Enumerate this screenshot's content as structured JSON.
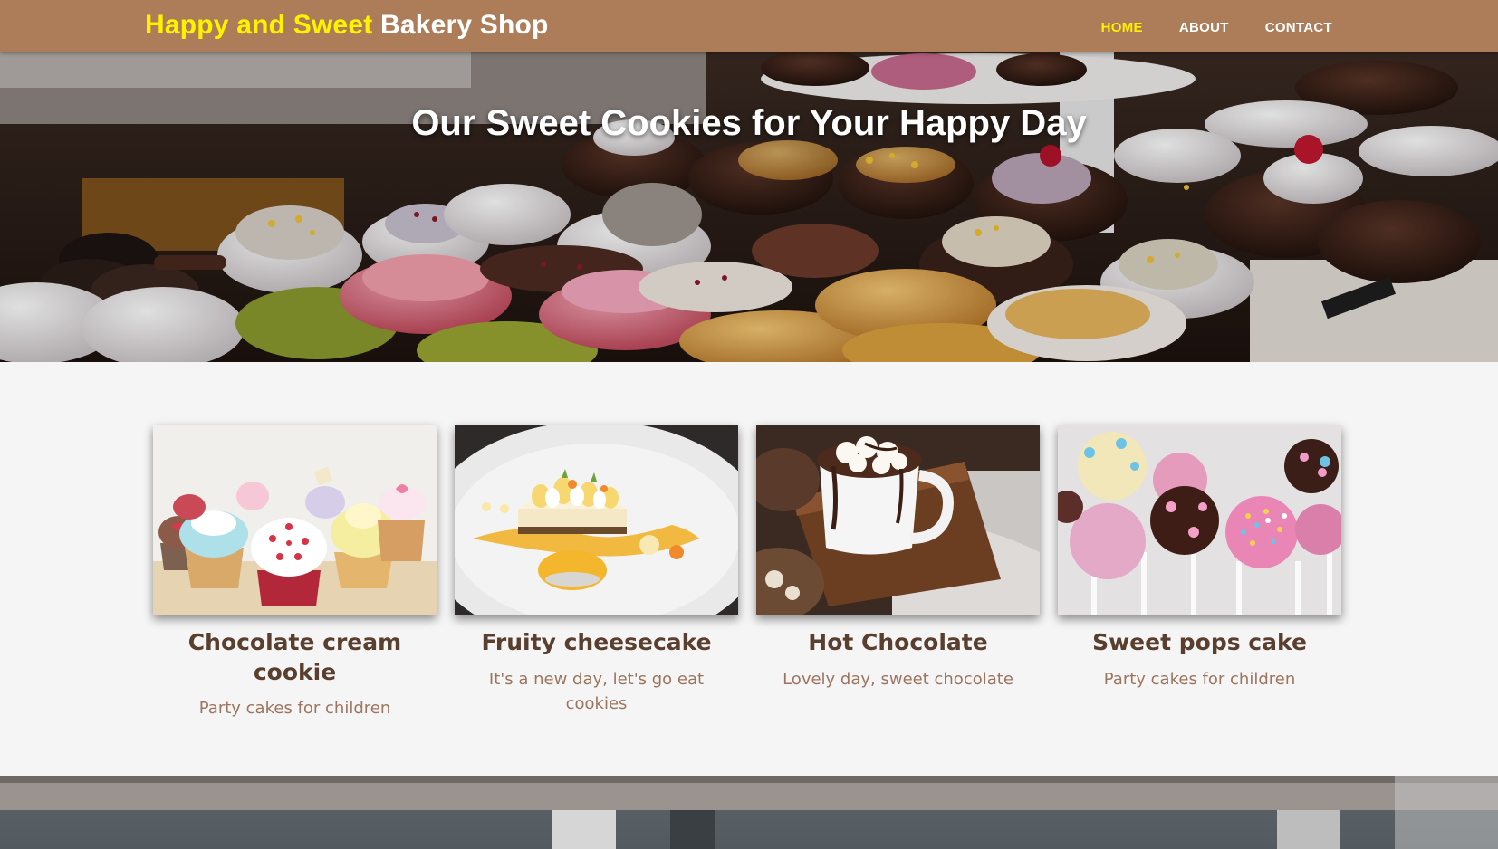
{
  "navbar": {
    "brand_part1": "Happy and Sweet",
    "brand_part2": "Bakery Shop",
    "links": [
      {
        "label": "HOME",
        "active": true
      },
      {
        "label": "ABOUT",
        "active": false
      },
      {
        "label": "CONTACT",
        "active": false
      }
    ]
  },
  "hero": {
    "title": "Our Sweet Cookies for Your Happy Day",
    "image": "pastry-display-photo"
  },
  "cards": [
    {
      "title": "Chocolate cream cookie",
      "subtitle": "Party cakes for children",
      "image": "cupcakes-photo"
    },
    {
      "title": "Fruity cheesecake",
      "subtitle": "It's a new day, let's go eat cookies",
      "image": "cheesecake-plate-photo"
    },
    {
      "title": "Hot Chocolate",
      "subtitle": "Lovely day, sweet chocolate",
      "image": "hot-chocolate-mug-photo"
    },
    {
      "title": "Sweet pops cake",
      "subtitle": "Party cakes for children",
      "image": "cake-pops-photo"
    }
  ],
  "colors": {
    "navbar_bg": "#ad7c59",
    "brand_accent": "#fff200",
    "active_link": "#fff200",
    "card_title": "#5a3e2e",
    "card_subtitle": "#9c7560",
    "page_bg": "#f5f5f5"
  }
}
